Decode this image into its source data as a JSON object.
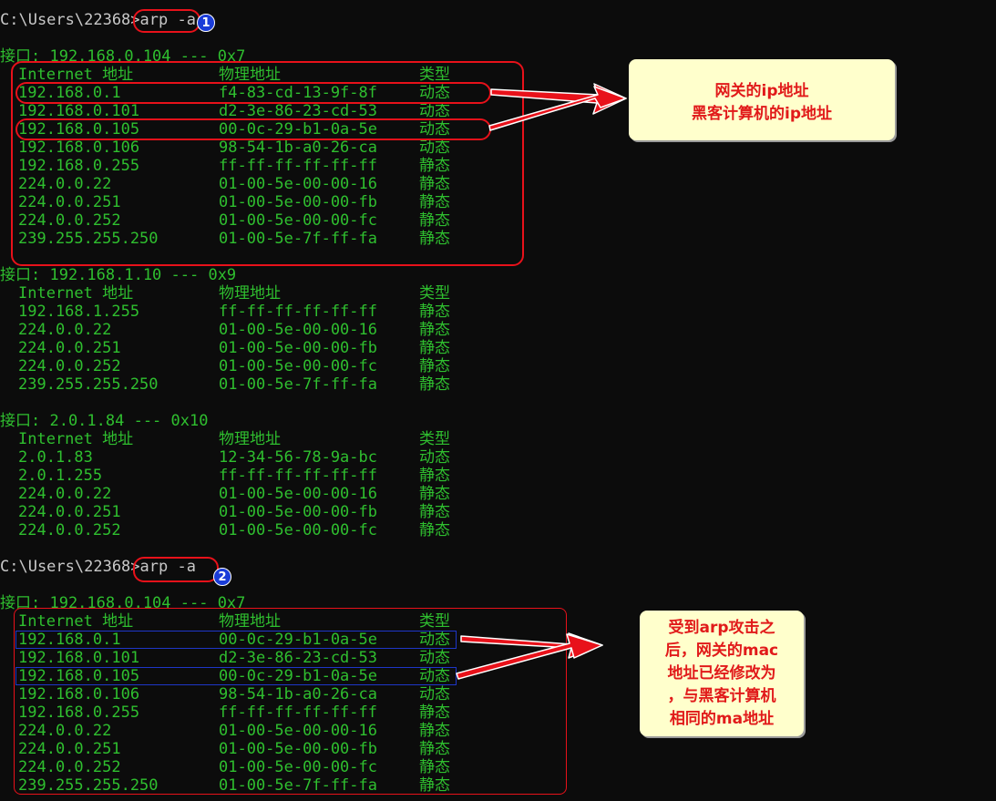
{
  "colors": {
    "background": "#0c0c0c",
    "text": "#2fbf2f",
    "highlight": "#e8111a",
    "note_bg": "#ffffcc"
  },
  "commands": [
    {
      "prompt": "C:\\Users\\22368>",
      "cmd": "arp -a",
      "badge": "1"
    },
    {
      "prompt": "C:\\Users\\22368>",
      "cmd": "arp -a",
      "badge": "2"
    }
  ],
  "header": {
    "internet": "Internet 地址",
    "physical": "物理地址",
    "type": "类型"
  },
  "sections": [
    {
      "title": "接口: 192.168.0.104 --- 0x7",
      "rows": [
        [
          "192.168.0.1",
          "f4-83-cd-13-9f-8f",
          "动态"
        ],
        [
          "192.168.0.101",
          "d2-3e-86-23-cd-53",
          "动态"
        ],
        [
          "192.168.0.105",
          "00-0c-29-b1-0a-5e",
          "动态"
        ],
        [
          "192.168.0.106",
          "98-54-1b-a0-26-ca",
          "动态"
        ],
        [
          "192.168.0.255",
          "ff-ff-ff-ff-ff-ff",
          "静态"
        ],
        [
          "224.0.0.22",
          "01-00-5e-00-00-16",
          "静态"
        ],
        [
          "224.0.0.251",
          "01-00-5e-00-00-fb",
          "静态"
        ],
        [
          "224.0.0.252",
          "01-00-5e-00-00-fc",
          "静态"
        ],
        [
          "239.255.255.250",
          "01-00-5e-7f-ff-fa",
          "静态"
        ]
      ]
    },
    {
      "title": "接口: 192.168.1.10 --- 0x9",
      "rows": [
        [
          "192.168.1.255",
          "ff-ff-ff-ff-ff-ff",
          "静态"
        ],
        [
          "224.0.0.22",
          "01-00-5e-00-00-16",
          "静态"
        ],
        [
          "224.0.0.251",
          "01-00-5e-00-00-fb",
          "静态"
        ],
        [
          "224.0.0.252",
          "01-00-5e-00-00-fc",
          "静态"
        ],
        [
          "239.255.255.250",
          "01-00-5e-7f-ff-fa",
          "静态"
        ]
      ]
    },
    {
      "title": "接口: 2.0.1.84 --- 0x10",
      "rows": [
        [
          "2.0.1.83",
          "12-34-56-78-9a-bc",
          "动态"
        ],
        [
          "2.0.1.255",
          "ff-ff-ff-ff-ff-ff",
          "静态"
        ],
        [
          "224.0.0.22",
          "01-00-5e-00-00-16",
          "静态"
        ],
        [
          "224.0.0.251",
          "01-00-5e-00-00-fb",
          "静态"
        ],
        [
          "224.0.0.252",
          "01-00-5e-00-00-fc",
          "静态"
        ]
      ]
    },
    {
      "title": "接口: 192.168.0.104 --- 0x7",
      "rows": [
        [
          "192.168.0.1",
          "00-0c-29-b1-0a-5e",
          "动态"
        ],
        [
          "192.168.0.101",
          "d2-3e-86-23-cd-53",
          "动态"
        ],
        [
          "192.168.0.105",
          "00-0c-29-b1-0a-5e",
          "动态"
        ],
        [
          "192.168.0.106",
          "98-54-1b-a0-26-ca",
          "动态"
        ],
        [
          "192.168.0.255",
          "ff-ff-ff-ff-ff-ff",
          "静态"
        ],
        [
          "224.0.0.22",
          "01-00-5e-00-00-16",
          "静态"
        ],
        [
          "224.0.0.251",
          "01-00-5e-00-00-fb",
          "静态"
        ],
        [
          "224.0.0.252",
          "01-00-5e-00-00-fc",
          "静态"
        ],
        [
          "239.255.255.250",
          "01-00-5e-7f-ff-fa",
          "静态"
        ]
      ]
    }
  ],
  "notes": [
    {
      "text": "网关的ip地址\n黑客计算机的ip地址"
    },
    {
      "text": "受到arp攻击之\n后，网关的mac\n地址已经修改为\n，与黑客计算机\n相同的ma地址"
    }
  ]
}
